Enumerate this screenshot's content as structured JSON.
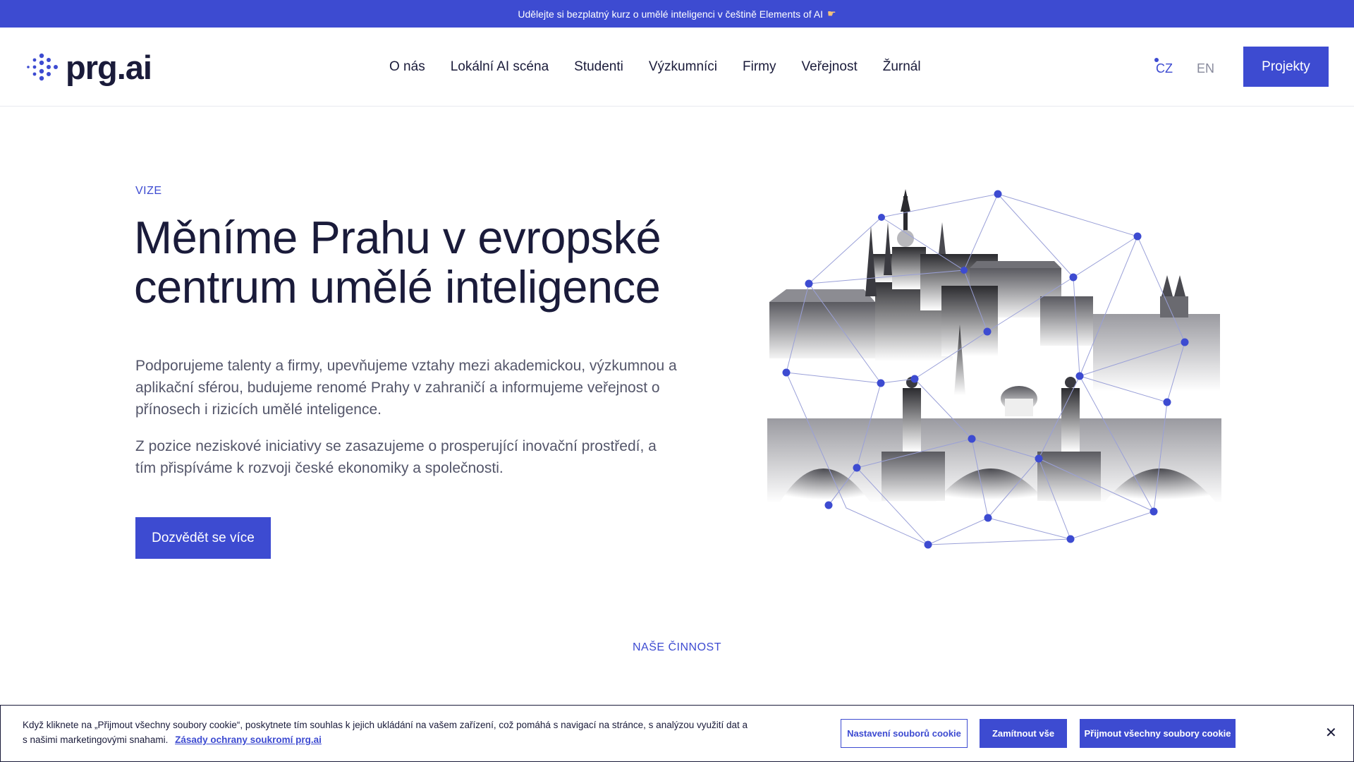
{
  "topbar": {
    "text": "Udělejte si bezplatný kurz o umělé inteligenci v češtině Elements of AI",
    "icon": "pointing-hand-icon"
  },
  "logo": {
    "text": "prg.ai"
  },
  "nav": {
    "items": [
      {
        "label": "O nás"
      },
      {
        "label": "Lokální AI scéna"
      },
      {
        "label": "Studenti"
      },
      {
        "label": "Výzkumníci"
      },
      {
        "label": "Firmy"
      },
      {
        "label": "Veřejnost"
      },
      {
        "label": "Žurnál"
      }
    ]
  },
  "lang": {
    "cz": "CZ",
    "en": "EN"
  },
  "header": {
    "projekty": "Projekty"
  },
  "hero": {
    "eyebrow": "VIZE",
    "title_line1": "Měníme Prahu v evropské",
    "title_line2": "centrum umělé inteligence",
    "para1": "Podporujeme talenty a firmy, upevňujeme vztahy mezi akademickou, výzkumnou a aplikační sférou, budujeme renomé Prahy v zahraničí a informujeme veřejnost o přínosech i rizicích umělé inteligence.",
    "para2": "Z pozice neziskové iniciativy se zasazujeme o prosperující inovační prostředí, a tím přispíváme k rozvoji české ekonomiky a společnosti.",
    "button": "Dozvědět se více"
  },
  "section": {
    "label": "NAŠE ČINNOST"
  },
  "cookie": {
    "text": "Když kliknete na „Přijmout všechny soubory cookie“, poskytnete tím souhlas k jejich ukládání na vašem zařízení, což pomáhá s navigací na stránce, s analýzou využití dat a s našimi marketingovými snahami.",
    "link": "Zásady ochrany soukromí prg.ai",
    "settings": "Nastavení souborů cookie",
    "reject": "Zamítnout vše",
    "accept": "Přijmout všechny soubory cookie",
    "close_icon": "close-icon"
  },
  "colors": {
    "accent": "#3d4bd1",
    "text": "#1a1b3a",
    "muted": "#54566a"
  }
}
